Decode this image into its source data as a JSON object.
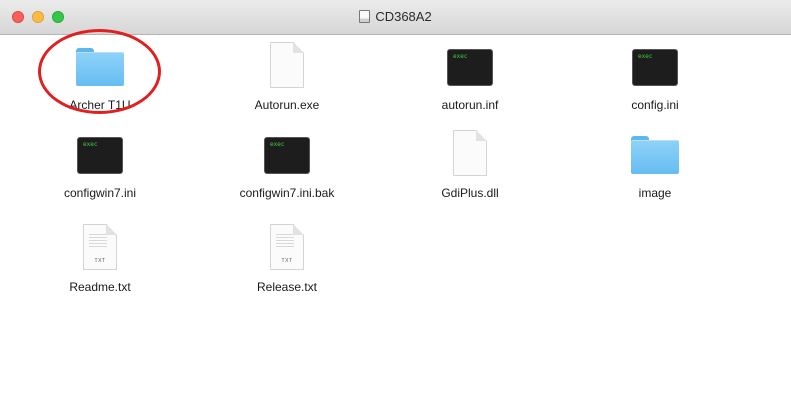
{
  "window": {
    "title": "CD368A2",
    "title_icon": "disk-icon"
  },
  "files": [
    {
      "name": "Archer T1U",
      "icon": "folder-icon"
    },
    {
      "name": "Autorun.exe",
      "icon": "document-icon"
    },
    {
      "name": "autorun.inf",
      "icon": "exec-terminal-icon",
      "icon_text": "exec"
    },
    {
      "name": "config.ini",
      "icon": "exec-terminal-icon",
      "icon_text": "exec"
    },
    {
      "name": "configwin7.ini",
      "icon": "exec-terminal-icon",
      "icon_text": "exec"
    },
    {
      "name": "configwin7.ini.bak",
      "icon": "exec-terminal-icon",
      "icon_text": "exec"
    },
    {
      "name": "GdiPlus.dll",
      "icon": "document-icon"
    },
    {
      "name": "image",
      "icon": "folder-icon"
    },
    {
      "name": "Readme.txt",
      "icon": "text-document-icon",
      "icon_text": "TXT"
    },
    {
      "name": "Release.txt",
      "icon": "text-document-icon",
      "icon_text": "TXT"
    }
  ],
  "annotation": {
    "color": "#e02020",
    "target": "Archer T1U"
  },
  "colors": {
    "close": "#fc605c",
    "minimize": "#fdbc40",
    "maximize": "#34c84a",
    "folder": "#7ccaf5"
  }
}
